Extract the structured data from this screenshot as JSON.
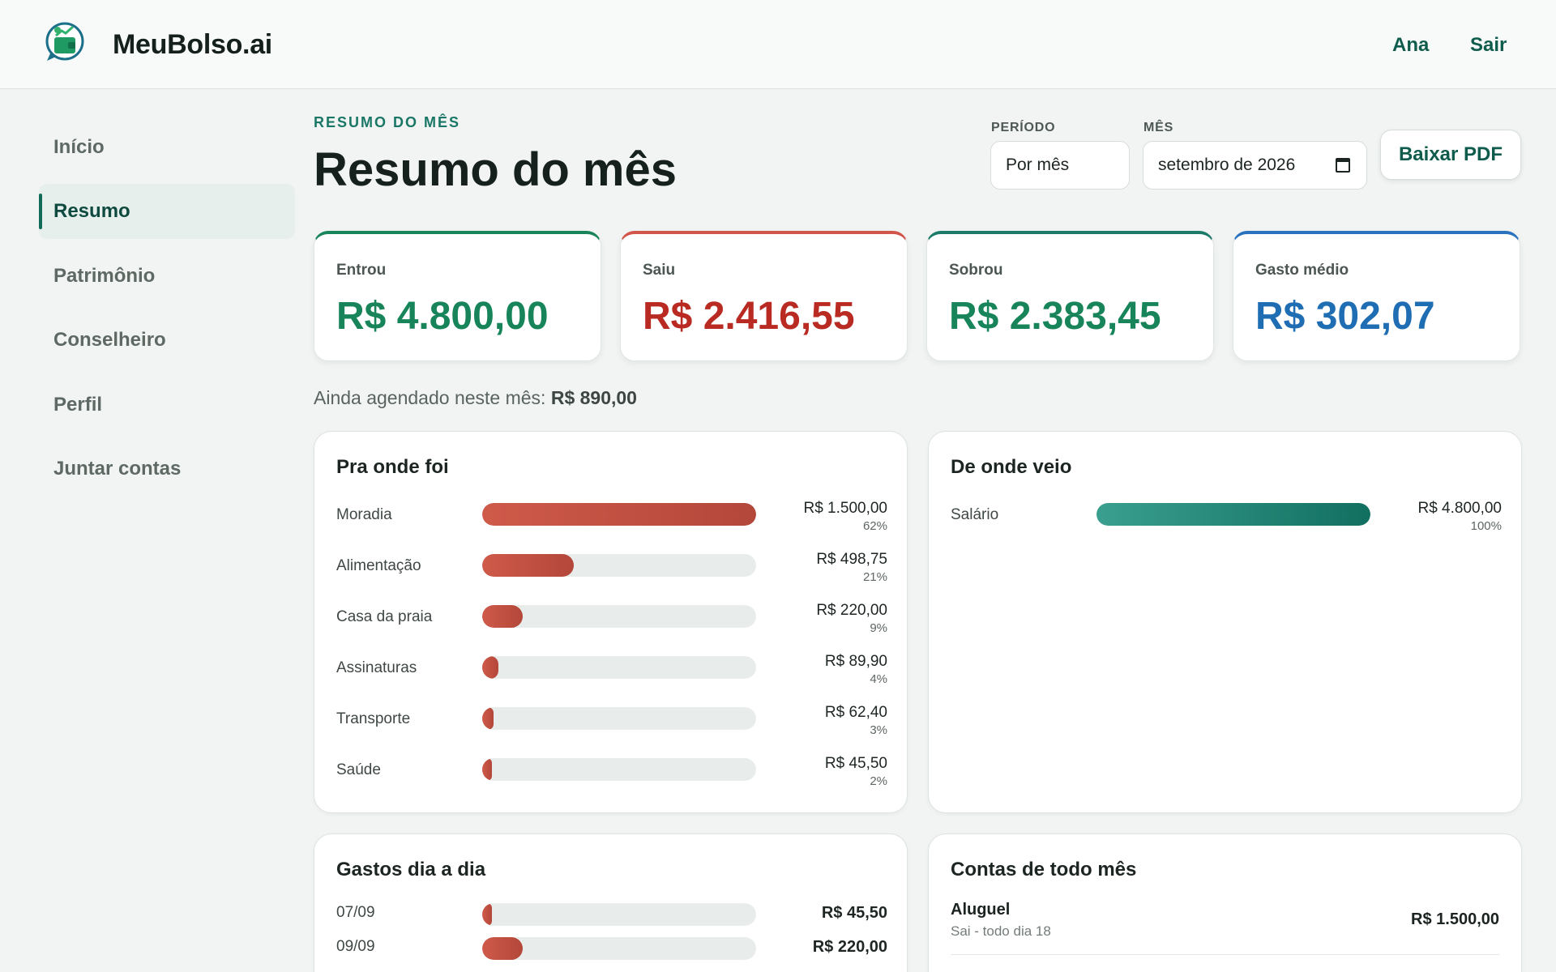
{
  "header": {
    "brand": "MeuBolso.ai",
    "logo_icon": "wallet-chart-icon",
    "user": "Ana",
    "logout": "Sair"
  },
  "sidebar": {
    "items": [
      {
        "label": "Início",
        "active": false
      },
      {
        "label": "Resumo",
        "active": true
      },
      {
        "label": "Patrimônio",
        "active": false
      },
      {
        "label": "Conselheiro",
        "active": false
      },
      {
        "label": "Perfil",
        "active": false
      },
      {
        "label": "Juntar contas",
        "active": false
      }
    ]
  },
  "page": {
    "eyebrow": "RESUMO DO MÊS",
    "title": "Resumo do mês",
    "period_label": "PERÍODO",
    "period_value": "Por mês",
    "month_label": "MÊS",
    "month_value": "setembro de 2026",
    "pdf_button": "Baixar PDF"
  },
  "stats": [
    {
      "label": "Entrou",
      "value": "R$ 4.800,00",
      "color": "#178459"
    },
    {
      "label": "Saiu",
      "value": "R$ 2.416,55",
      "color": "#b82a22"
    },
    {
      "label": "Sobrou",
      "value": "R$ 2.383,45",
      "color": "#178459"
    },
    {
      "label": "Gasto médio",
      "value": "R$ 302,07",
      "color": "#1f6db3"
    }
  ],
  "stat_top_colors": [
    "#178459",
    "#d2554b",
    "#1c7a69",
    "#2a72bd"
  ],
  "scheduled": {
    "text": "Ainda agendado neste mês:",
    "amount": "R$ 890,00"
  },
  "outflows": {
    "title": "Pra onde foi",
    "items": [
      {
        "label": "Moradia",
        "amount": "R$ 1.500,00",
        "pct": "62%",
        "fraction": 1.0
      },
      {
        "label": "Alimentação",
        "amount": "R$ 498,75",
        "pct": "21%",
        "fraction": 0.333
      },
      {
        "label": "Casa da praia",
        "amount": "R$ 220,00",
        "pct": "9%",
        "fraction": 0.147
      },
      {
        "label": "Assinaturas",
        "amount": "R$ 89,90",
        "pct": "4%",
        "fraction": 0.06
      },
      {
        "label": "Transporte",
        "amount": "R$ 62,40",
        "pct": "3%",
        "fraction": 0.042
      },
      {
        "label": "Saúde",
        "amount": "R$ 45,50",
        "pct": "2%",
        "fraction": 0.03
      }
    ]
  },
  "inflows": {
    "title": "De onde veio",
    "items": [
      {
        "label": "Salário",
        "amount": "R$ 4.800,00",
        "pct": "100%",
        "fraction": 1.0
      }
    ]
  },
  "daily": {
    "title": "Gastos dia a dia",
    "items": [
      {
        "label": "07/09",
        "amount": "R$ 45,50",
        "fraction": 0.03
      },
      {
        "label": "09/09",
        "amount": "R$ 220,00",
        "fraction": 0.147
      }
    ]
  },
  "recurring": {
    "title": "Contas de todo mês",
    "items": [
      {
        "name": "Aluguel",
        "detail": "Sai - todo dia 18",
        "amount": "R$ 1.500,00"
      }
    ]
  }
}
